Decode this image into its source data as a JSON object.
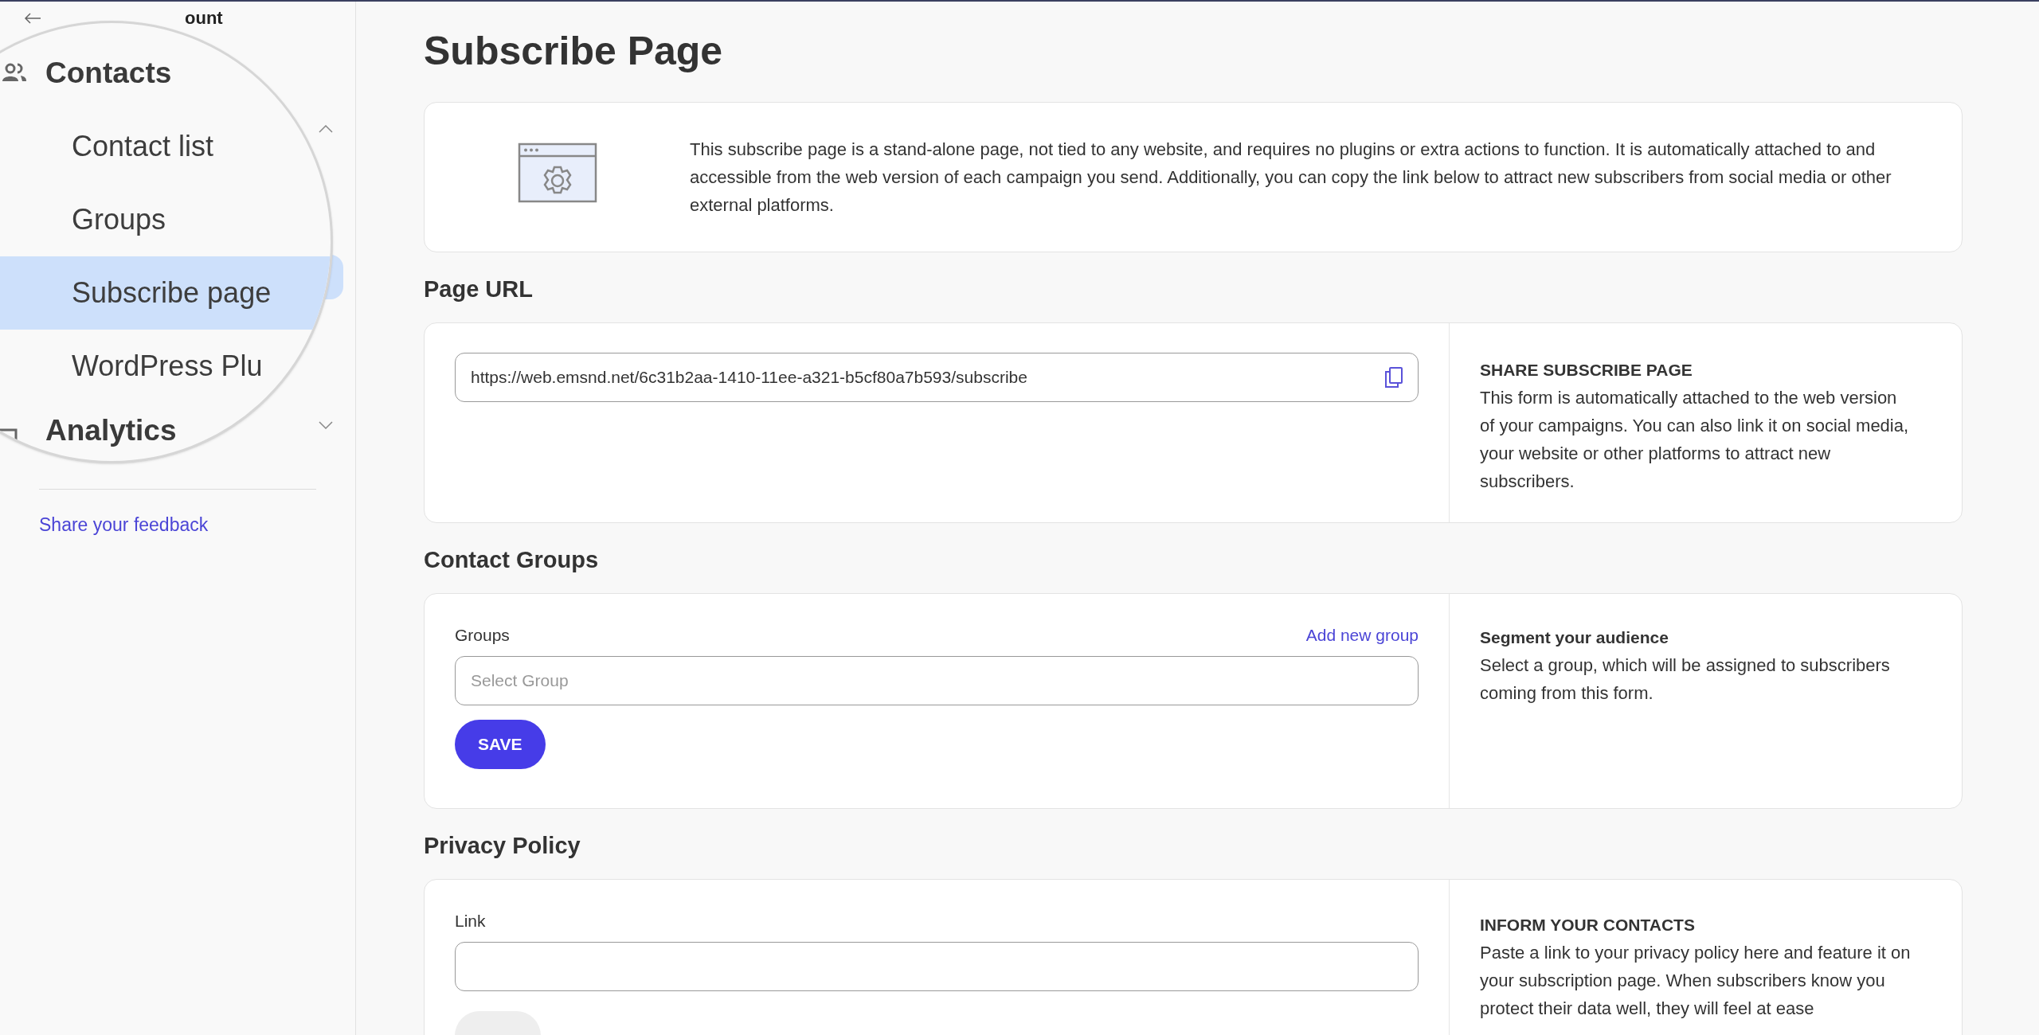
{
  "sidebar": {
    "back_link": {
      "label": "ount"
    },
    "sections": [
      {
        "label": "Contacts",
        "expanded": true,
        "children": [
          {
            "label": "Contact list",
            "selected": false
          },
          {
            "label": "Groups",
            "selected": false
          },
          {
            "label": "Subscribe page",
            "selected": true
          },
          {
            "label": "WordPress Plu",
            "selected": false
          }
        ]
      },
      {
        "label": "Analytics",
        "expanded": false
      }
    ],
    "feedback_link": "Share your feedback"
  },
  "page_title": "Subscribe Page",
  "intro": {
    "text": "This subscribe page is a stand-alone page, not tied to any website, and requires no plugins or extra actions to function. It is automatically attached to and accessible from the web version of each campaign you send. Additionally, you can copy the link below to attract new subscribers from social media or other external platforms."
  },
  "sections": [
    {
      "heading": "Page URL",
      "field": {
        "value": "https://web.emsnd.net/6c31b2aa-1410-11ee-a321-b5cf80a7b593/subscribe"
      },
      "aside": {
        "title": "SHARE SUBSCRIBE PAGE",
        "text": "This form is automatically attached to the web version of your campaigns. You can also link it on social media, your website or other platforms to attract new subscribers."
      }
    },
    {
      "heading": "Contact Groups",
      "field": {
        "label": "Groups",
        "link": "Add new group",
        "placeholder": "Select Group"
      },
      "button": {
        "label": "SAVE",
        "disabled": false
      },
      "aside": {
        "title": "Segment your audience",
        "text": "Select a group, which will be assigned to subscribers coming from this form."
      }
    },
    {
      "heading": "Privacy Policy",
      "field": {
        "label": "Link"
      },
      "button": {
        "disabled": true
      },
      "aside": {
        "title": "INFORM YOUR CONTACTS",
        "text": "Paste a link to your privacy policy here and feature it on your subscription page. When subscribers know you protect their data well, they will feel at ease"
      }
    }
  ]
}
